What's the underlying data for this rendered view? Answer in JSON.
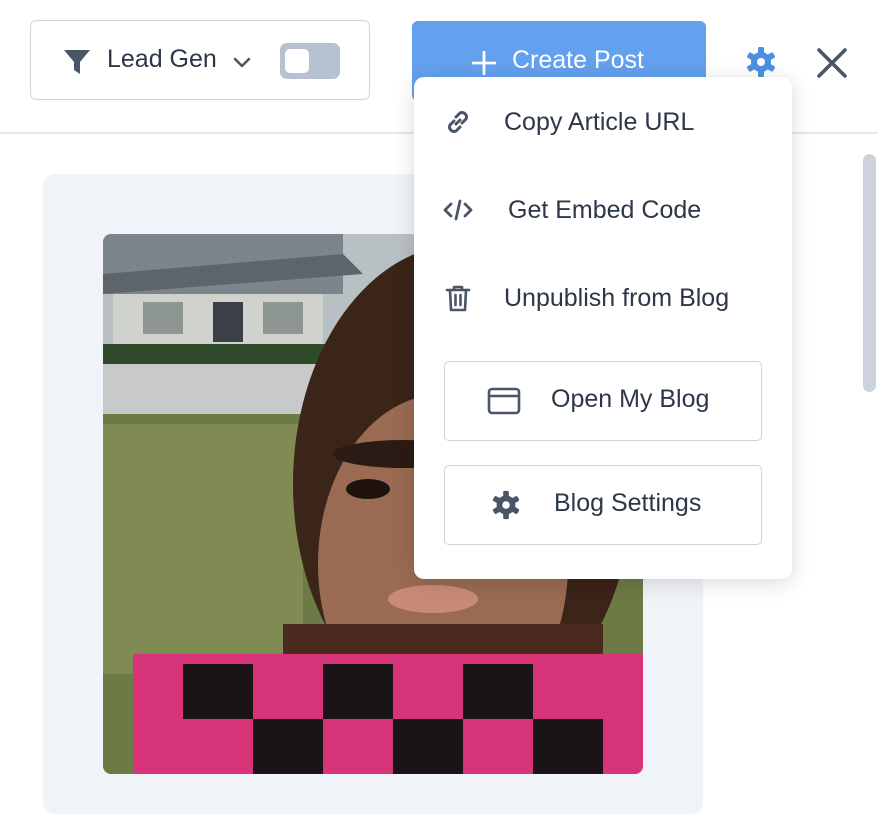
{
  "toolbar": {
    "filter_label": "Lead Gen",
    "filter_icon": "filter-icon",
    "toggle_on": false,
    "create_label": "Create Post",
    "settings_icon": "gear-icon",
    "close_icon": "close-icon"
  },
  "menu": {
    "items": [
      {
        "label": "Copy Article URL",
        "icon": "link-icon"
      },
      {
        "label": "Get Embed Code",
        "icon": "code-icon"
      },
      {
        "label": "Unpublish from Blog",
        "icon": "trash-icon"
      }
    ],
    "buttons": [
      {
        "label": "Open My Blog",
        "icon": "browser-window-icon"
      },
      {
        "label": "Blog Settings",
        "icon": "gear-icon"
      }
    ]
  },
  "colors": {
    "accent": "#63a0ee",
    "icon": "#4a5568",
    "border": "#cbd5e0",
    "card_bg": "#f0f3f7"
  }
}
